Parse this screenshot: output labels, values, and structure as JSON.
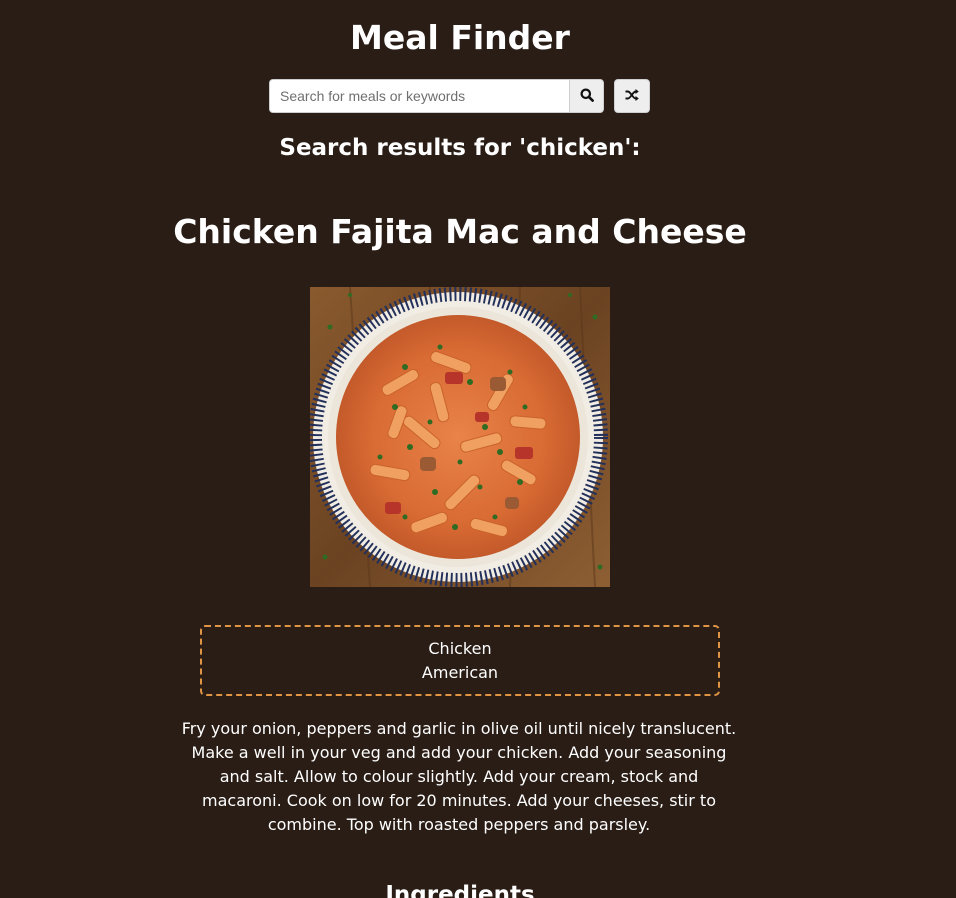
{
  "app": {
    "title": "Meal Finder"
  },
  "search": {
    "placeholder": "Search for meals or keywords",
    "value": "",
    "search_icon": "search-icon",
    "random_icon": "shuffle-icon"
  },
  "results": {
    "heading": "Search results for 'chicken':"
  },
  "meal": {
    "title": "Chicken Fajita Mac and Cheese",
    "image_alt": "Chicken Fajita Mac and Cheese",
    "category": "Chicken",
    "area": "American",
    "instructions": "Fry your onion, peppers and garlic in olive oil until nicely translucent. Make a well in your veg and add your chicken. Add your seasoning and salt. Allow to colour slightly. Add your cream, stock and macaroni. Cook on low for 20 minutes. Add your cheeses, stir to combine. Top with roasted peppers and parsley.",
    "ingredients_heading": "Ingredients"
  },
  "colors": {
    "background": "#2a1d16",
    "tag_border": "#e09545",
    "text": "#ffffff"
  }
}
